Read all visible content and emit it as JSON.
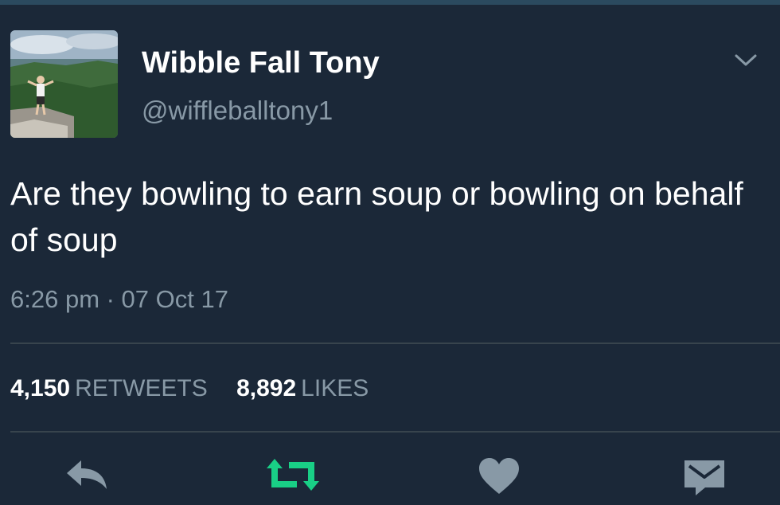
{
  "tweet": {
    "display_name": "Wibble Fall Tony",
    "handle": "@wiffleballtony1",
    "text": "Are they bowling to earn soup or bowling on behalf of soup",
    "timestamp": "6:26 pm · 07 Oct 17",
    "retweets_count": "4,150",
    "retweets_label": "RETWEETS",
    "likes_count": "8,892",
    "likes_label": "LIKES"
  },
  "icons": {
    "reply": "reply-icon",
    "retweet": "retweet-icon",
    "like": "heart-icon",
    "message": "envelope-icon",
    "menu": "chevron-down-icon"
  },
  "colors": {
    "background": "#1b2838",
    "secondary_text": "#8899a6",
    "retweet_active": "#19cf86",
    "divider": "#38444d"
  }
}
